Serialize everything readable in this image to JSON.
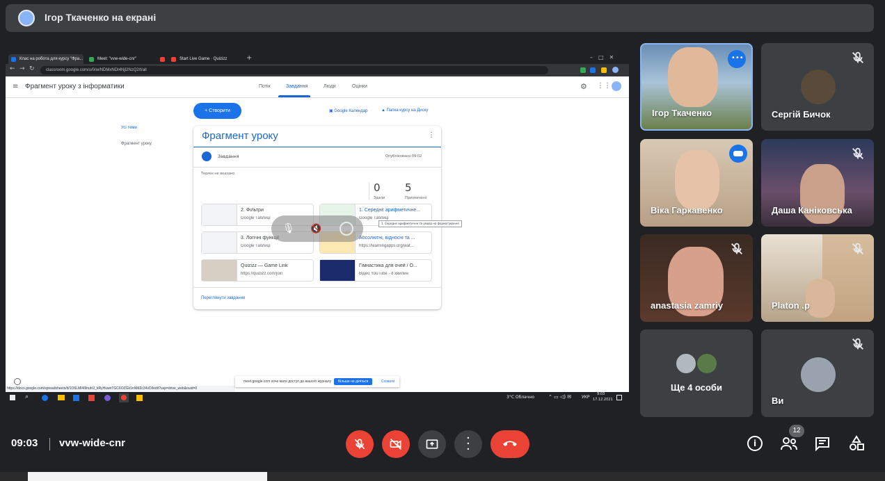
{
  "presenter_bar": {
    "title": "Ігор Ткаченко на екрані"
  },
  "browser": {
    "tabs": [
      {
        "label": "Клас на робота для курсу \"Фра...",
        "color": "#1a73e8"
      },
      {
        "label": "Meet: \"vvw-wide-cnr\"",
        "color": "#34a853"
      },
      {
        "label": "",
        "color": "#ea4335"
      },
      {
        "label": "Start Live Game · Quizizz",
        "color": "#ea4335"
      }
    ],
    "url": "classroom.google.com/u/0/w/NDMxNDI4Njl2NzQ2/t/all",
    "status_url": "https://docs.google.com/spreadsheets/d/1O6LMI4l9nuhU_kRyHuwnTGC6OZGk1nNMZc34vDl/edit?usp=drive_web&ouid=0"
  },
  "classroom": {
    "title": "Фрагмент уроку з інформатики",
    "tabs": [
      "Потік",
      "Завдання",
      "Люди",
      "Оцінки"
    ],
    "create_label": "Створити",
    "calendar_link": "Google Календар",
    "drive_link": "Папка курсу на Диску",
    "sidebar": {
      "all_topics": "Усі теми",
      "topic": "Фрагмент уроку"
    },
    "card": {
      "title": "Фрагмент уроку",
      "assignment_label": "Завдання",
      "published": "Опубліковано 09:02",
      "due": "Термін не вказано",
      "handed_in_count": "0",
      "handed_in_label": "Здали",
      "assigned_count": "5",
      "assigned_label": "Призначено",
      "attachments": [
        {
          "title": "2. Фільтри",
          "sub": "Google Таблиці"
        },
        {
          "title": "1. Середнє арифметичне...",
          "sub": "Google Таблиці"
        },
        {
          "title": "3. Логічні функції",
          "sub": "Google Таблиці"
        },
        {
          "title": "Абсолютні, відносні та ...",
          "sub": "https://learningapps.org/wat..."
        },
        {
          "title": "Quizizz — Game Link",
          "sub": "https://quizizz.com/join"
        },
        {
          "title": "Гімнастика для очей / O...",
          "sub": "Відео YouTube · 8 хвилин"
        }
      ],
      "tooltip": "1. Середнє арифметичне та умова на форматування",
      "view_link": "Переглянути завдання"
    },
    "cookie": {
      "text": "meet.google.com хоче мати доступ до вашого журналу",
      "allow": "Більше не діліться",
      "close": "Сховати"
    }
  },
  "win_taskbar": {
    "weather": "3°C Облачно",
    "lang": "УКР",
    "time": "9:03",
    "date": "17.12.2021"
  },
  "participants": [
    {
      "name": "Ігор Ткаченко",
      "muted": false,
      "active": true
    },
    {
      "name": "Сергій Бичок",
      "muted": true
    },
    {
      "name": "Віка Гаркавенко",
      "muted": false,
      "speaking": true
    },
    {
      "name": "Даша Каніковська",
      "muted": true
    },
    {
      "name": "anastasia zamriy",
      "muted": true
    },
    {
      "name": "Platon .p",
      "muted": true
    },
    {
      "name": "Ще 4 особи",
      "muted": false
    },
    {
      "name": "Ви",
      "muted": true
    }
  ],
  "controls": {
    "time": "09:03",
    "meeting_code": "vvw-wide-cnr",
    "participant_count": "12"
  },
  "colors": {
    "meet_bg": "#202124",
    "tile_bg": "#3c4043",
    "accent": "#1a73e8",
    "danger": "#ea4335",
    "active_border": "#8ab4f8"
  }
}
